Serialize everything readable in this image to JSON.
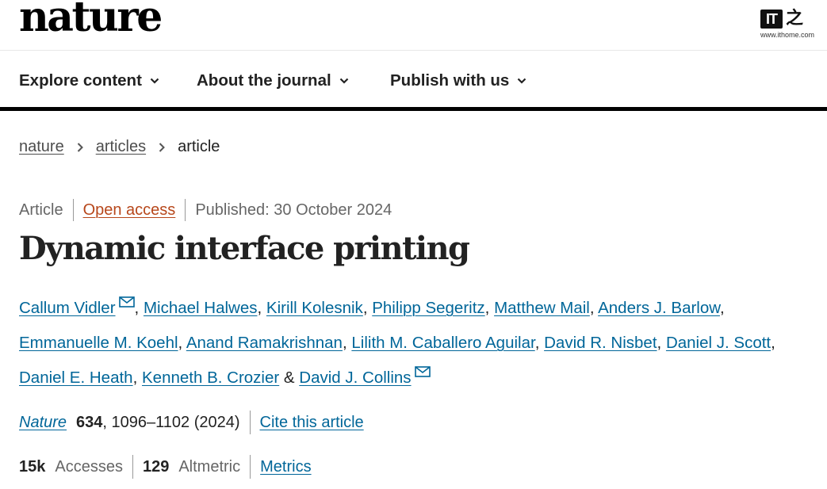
{
  "header": {
    "logo": "nature",
    "watermark": {
      "mark": "IT",
      "char": "之",
      "url": "www.ithome.com"
    }
  },
  "nav": {
    "items": [
      {
        "label": "Explore content"
      },
      {
        "label": "About the journal"
      },
      {
        "label": "Publish with us"
      }
    ]
  },
  "breadcrumb": {
    "items": [
      "nature",
      "articles",
      "article"
    ]
  },
  "article": {
    "type": "Article",
    "access": "Open access",
    "published": "Published: 30 October 2024",
    "title": "Dynamic interface printing",
    "authors": [
      "Callum Vidler",
      "Michael Halwes",
      "Kirill Kolesnik",
      "Philipp Segeritz",
      "Matthew Mail",
      "Anders J. Barlow",
      "Emmanuelle M. Koehl",
      "Anand Ramakrishnan",
      "Lilith M. Caballero Aguilar",
      "David R. Nisbet",
      "Daniel J. Scott",
      "Daniel E. Heath",
      "Kenneth B. Crozier",
      "David J. Collins"
    ],
    "separator": ", ",
    "ampersand": " & "
  },
  "citation": {
    "journal": "Nature",
    "volume": "634",
    "pages_year": ", 1096–1102 (2024)",
    "cite_label": "Cite this article"
  },
  "metrics": {
    "accesses_value": "15k",
    "accesses_label": "Accesses",
    "altmetric_value": "129",
    "altmetric_label": "Altmetric",
    "metrics_link": "Metrics"
  },
  "colors": {
    "link": "#006699",
    "open_access": "#b7471b",
    "muted": "#666666",
    "text": "#222222"
  },
  "icons": [
    "chevron-down-icon",
    "chevron-right-icon",
    "mail-icon"
  ]
}
